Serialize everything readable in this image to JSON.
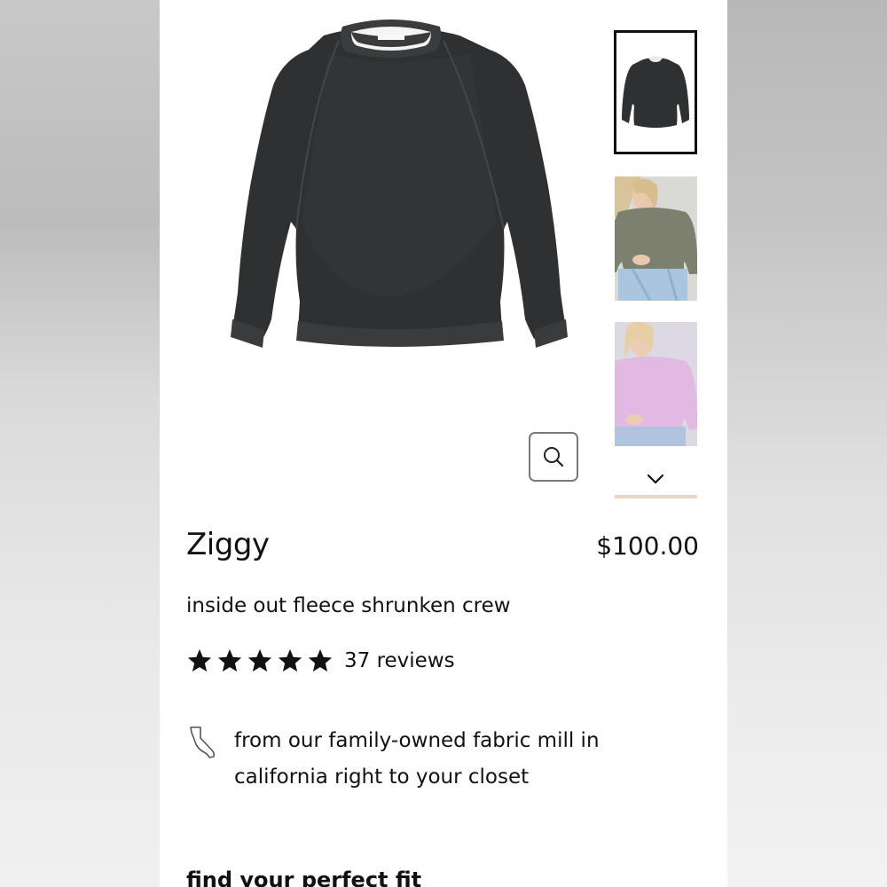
{
  "product": {
    "name": "Ziggy",
    "price": "$100.00",
    "subtitle": "inside out fleece shrunken crew",
    "rating": 5,
    "rating_max": 5,
    "reviews_label": "37 reviews"
  },
  "origin": {
    "icon": "california-state-icon",
    "text": "from our family-owned fabric mill in california right to your closet"
  },
  "fit": {
    "heading": "find your perfect fit"
  },
  "gallery": {
    "main_image": "black-sweatshirt-product-image",
    "thumbnails": [
      "black-sweatshirt-thumbnail",
      "olive-sweatshirt-model-thumbnail",
      "pink-sweatshirt-model-thumbnail"
    ],
    "active_index": 0
  },
  "icons": {
    "zoom": "magnifier-icon",
    "scroll_down": "chevron-down-icon",
    "star": "star-icon"
  },
  "colors": {
    "text": "#111111",
    "sweatshirt": "#2f3031",
    "zoom_border": "#7a7a7a"
  }
}
